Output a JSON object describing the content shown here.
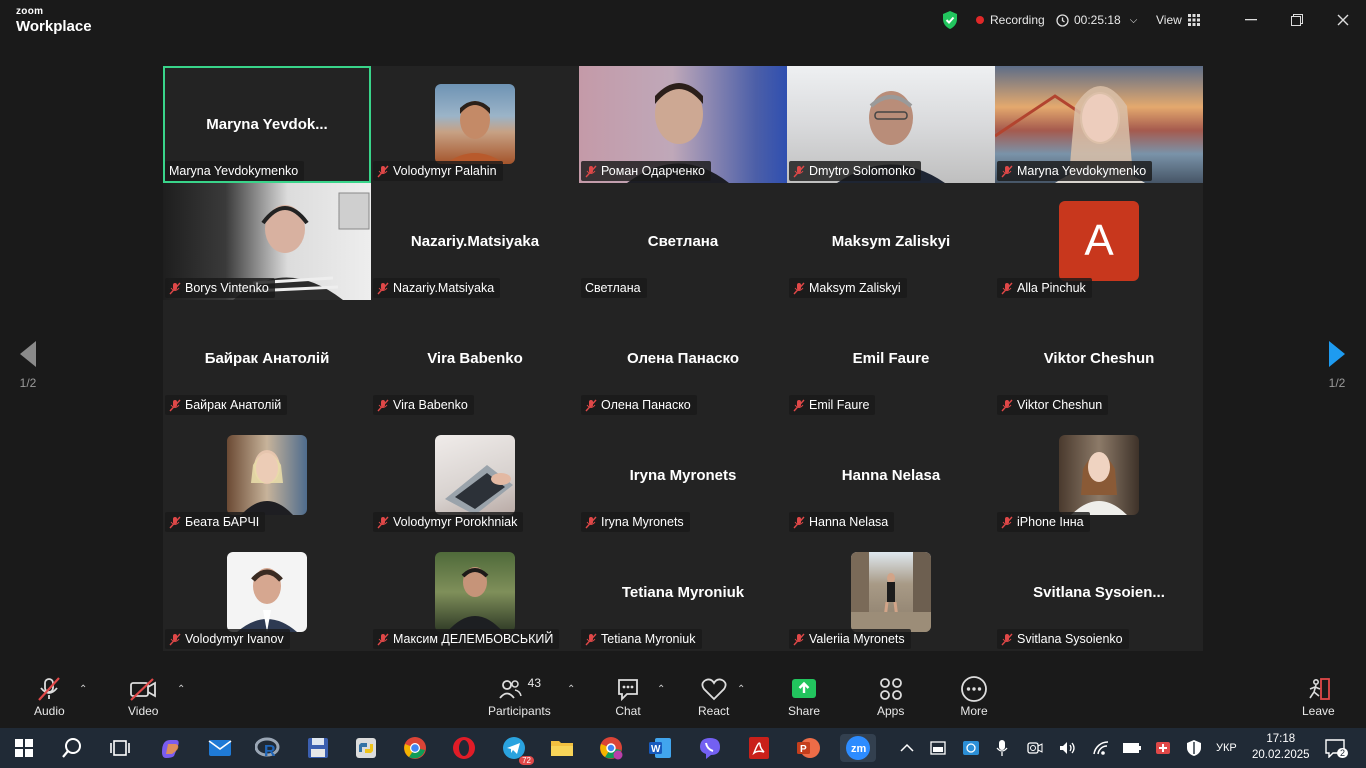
{
  "app": {
    "brand_top": "zoom",
    "brand_bottom": "Workplace"
  },
  "titlebar": {
    "recording_label": "Recording",
    "timer": "00:25:18",
    "view_label": "View"
  },
  "pager": {
    "left": "1/2",
    "right": "1/2"
  },
  "tiles": [
    {
      "name": "Maryna Yevdokymenko",
      "display": "Maryna  Yevdok...",
      "mic_off": false
    },
    {
      "name": "Volodymyr Palahin",
      "mic_off": true
    },
    {
      "name": "Роман Одарченко",
      "mic_off": true
    },
    {
      "name": "Dmytro Solomonko",
      "mic_off": true
    },
    {
      "name": "Maryna Yevdokymenko",
      "mic_off": true
    },
    {
      "name": "Borys Vintenko",
      "mic_off": true
    },
    {
      "name": "Nazariy.Matsiyaka",
      "display": "Nazariy.Matsiyaka",
      "mic_off": true
    },
    {
      "name": "Светлана",
      "display": "Светлана",
      "mic_off": false
    },
    {
      "name": "Maksym Zaliskyi",
      "display": "Maksym Zaliskyi",
      "mic_off": true
    },
    {
      "name": "Alla Pinchuk",
      "avatar_letter": "A",
      "mic_off": true
    },
    {
      "name": "Байрак Анатолій",
      "display": "Байрак Анатолій",
      "mic_off": true
    },
    {
      "name": "Vira Babenko",
      "display": "Vira Babenko",
      "mic_off": true
    },
    {
      "name": "Олена Панаско",
      "display": "Олена Панаско",
      "mic_off": true
    },
    {
      "name": "Emil Faure",
      "display": "Emil Faure",
      "mic_off": true
    },
    {
      "name": "Viktor Cheshun",
      "display": "Viktor Cheshun",
      "mic_off": true
    },
    {
      "name": "Беата БАРЧІ",
      "mic_off": true
    },
    {
      "name": "Volodymyr Porokhniak",
      "mic_off": true
    },
    {
      "name": "Iryna Myronets",
      "display": "Iryna Myronets",
      "mic_off": true
    },
    {
      "name": "Hanna Nelasa",
      "display": "Hanna Nelasa",
      "mic_off": true
    },
    {
      "name": "iPhone Інна",
      "mic_off": true
    },
    {
      "name": "Volodymyr Ivanov",
      "mic_off": true
    },
    {
      "name": "Максим ДЕЛЕМБОВСЬКИЙ",
      "mic_off": true
    },
    {
      "name": "Tetiana Myroniuk",
      "display": "Tetiana Myroniuk",
      "mic_off": true
    },
    {
      "name": "Valeriia Myronets",
      "mic_off": true
    },
    {
      "name": "Svitlana Sysoienko",
      "display": "Svitlana  Sysoien...",
      "mic_off": true
    }
  ],
  "toolbar": {
    "audio": "Audio",
    "video": "Video",
    "participants": "Participants",
    "participants_count": "43",
    "chat": "Chat",
    "react": "React",
    "share": "Share",
    "apps": "Apps",
    "more": "More",
    "leave": "Leave"
  },
  "taskbar": {
    "telegram_badge": "72",
    "lang": "УКР",
    "time": "17:18",
    "date": "20.02.2025",
    "notif_count": "2"
  },
  "colors": {
    "active_speaker": "#39d48a",
    "record_dot": "#e02828",
    "share_green": "#22c55e",
    "avatar_orange": "#c8371d"
  }
}
